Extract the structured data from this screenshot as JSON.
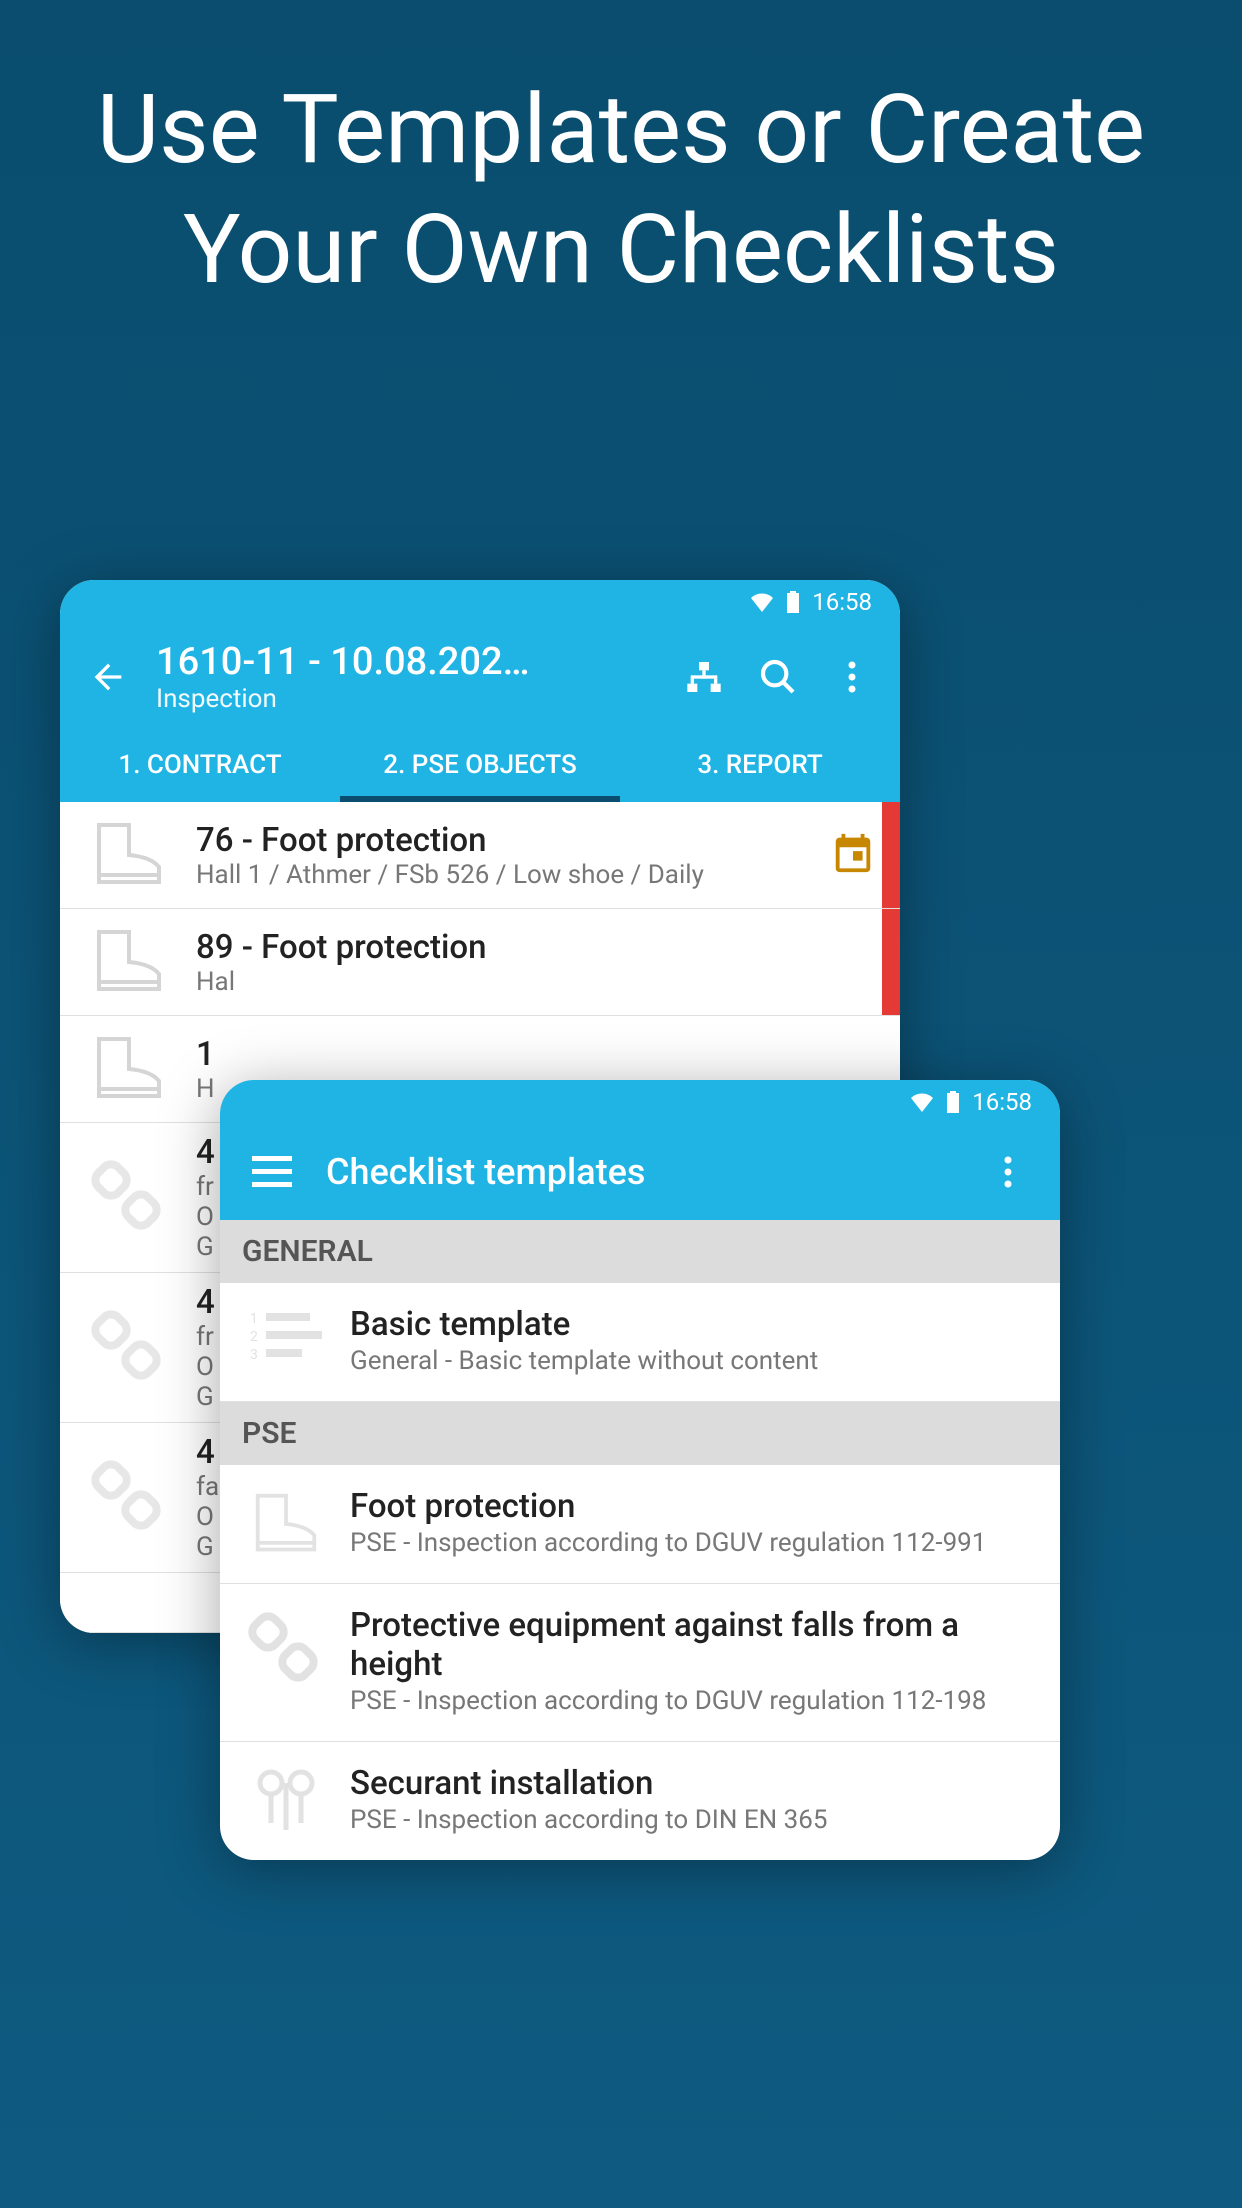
{
  "promo": {
    "title": "Use Templates or Create Your Own Checklists"
  },
  "status": {
    "time": "16:58"
  },
  "back_phone": {
    "title": "1610-11 - 10.08.202…",
    "subtitle": "Inspection",
    "tabs": [
      "1. CONTRACT",
      "2. PSE OBJECTS",
      "3. REPORT"
    ],
    "active_tab": 1,
    "items": [
      {
        "title": "76 - Foot protection",
        "sub": "Hall 1 / Athmer / FSb 526 / Low shoe / Daily",
        "icon": "boot",
        "calendar": true,
        "red": true
      },
      {
        "title": "89 - Foot protection",
        "sub": "Hal",
        "icon": "boot",
        "red": true
      },
      {
        "title": "1",
        "sub": "H",
        "icon": "boot"
      },
      {
        "title": "4",
        "sub": "fr",
        "sub2": "O",
        "sub3": "G",
        "icon": "chain"
      },
      {
        "title": "4",
        "sub": "fr",
        "sub2": "O",
        "sub3": "G",
        "icon": "chain"
      },
      {
        "title": "4",
        "sub": "fa",
        "sub2": "O",
        "sub3": "G",
        "icon": "chain"
      }
    ]
  },
  "front_phone": {
    "title": "Checklist templates",
    "sections": [
      {
        "header": "GENERAL",
        "items": [
          {
            "title": "Basic template",
            "sub": "General - Basic template without content",
            "icon": "list"
          }
        ]
      },
      {
        "header": "PSE",
        "items": [
          {
            "title": "Foot protection",
            "sub": "PSE - Inspection according to DGUV regulation 112-991",
            "icon": "boot"
          },
          {
            "title": "Protective equipment against falls from a height",
            "sub": "PSE - Inspection according to DGUV regulation 112-198",
            "icon": "chain"
          },
          {
            "title": "Securant installation",
            "sub": "PSE - Inspection according to DIN EN 365",
            "icon": "anchor"
          }
        ]
      }
    ]
  }
}
